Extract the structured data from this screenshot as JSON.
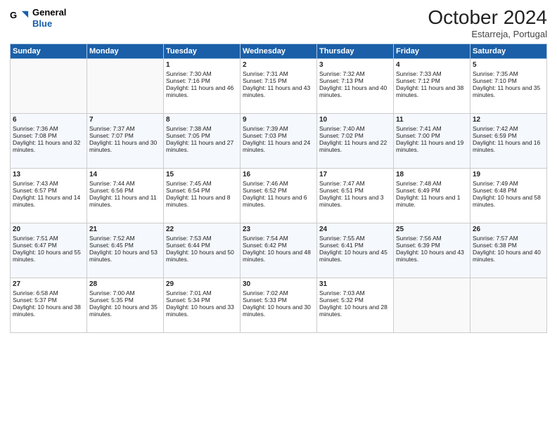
{
  "logo": {
    "line1": "General",
    "line2": "Blue"
  },
  "header": {
    "month_year": "October 2024",
    "location": "Estarreja, Portugal"
  },
  "days_of_week": [
    "Sunday",
    "Monday",
    "Tuesday",
    "Wednesday",
    "Thursday",
    "Friday",
    "Saturday"
  ],
  "weeks": [
    [
      {
        "day": "",
        "sunrise": "",
        "sunset": "",
        "daylight": ""
      },
      {
        "day": "",
        "sunrise": "",
        "sunset": "",
        "daylight": ""
      },
      {
        "day": "1",
        "sunrise": "Sunrise: 7:30 AM",
        "sunset": "Sunset: 7:16 PM",
        "daylight": "Daylight: 11 hours and 46 minutes."
      },
      {
        "day": "2",
        "sunrise": "Sunrise: 7:31 AM",
        "sunset": "Sunset: 7:15 PM",
        "daylight": "Daylight: 11 hours and 43 minutes."
      },
      {
        "day": "3",
        "sunrise": "Sunrise: 7:32 AM",
        "sunset": "Sunset: 7:13 PM",
        "daylight": "Daylight: 11 hours and 40 minutes."
      },
      {
        "day": "4",
        "sunrise": "Sunrise: 7:33 AM",
        "sunset": "Sunset: 7:12 PM",
        "daylight": "Daylight: 11 hours and 38 minutes."
      },
      {
        "day": "5",
        "sunrise": "Sunrise: 7:35 AM",
        "sunset": "Sunset: 7:10 PM",
        "daylight": "Daylight: 11 hours and 35 minutes."
      }
    ],
    [
      {
        "day": "6",
        "sunrise": "Sunrise: 7:36 AM",
        "sunset": "Sunset: 7:08 PM",
        "daylight": "Daylight: 11 hours and 32 minutes."
      },
      {
        "day": "7",
        "sunrise": "Sunrise: 7:37 AM",
        "sunset": "Sunset: 7:07 PM",
        "daylight": "Daylight: 11 hours and 30 minutes."
      },
      {
        "day": "8",
        "sunrise": "Sunrise: 7:38 AM",
        "sunset": "Sunset: 7:05 PM",
        "daylight": "Daylight: 11 hours and 27 minutes."
      },
      {
        "day": "9",
        "sunrise": "Sunrise: 7:39 AM",
        "sunset": "Sunset: 7:03 PM",
        "daylight": "Daylight: 11 hours and 24 minutes."
      },
      {
        "day": "10",
        "sunrise": "Sunrise: 7:40 AM",
        "sunset": "Sunset: 7:02 PM",
        "daylight": "Daylight: 11 hours and 22 minutes."
      },
      {
        "day": "11",
        "sunrise": "Sunrise: 7:41 AM",
        "sunset": "Sunset: 7:00 PM",
        "daylight": "Daylight: 11 hours and 19 minutes."
      },
      {
        "day": "12",
        "sunrise": "Sunrise: 7:42 AM",
        "sunset": "Sunset: 6:59 PM",
        "daylight": "Daylight: 11 hours and 16 minutes."
      }
    ],
    [
      {
        "day": "13",
        "sunrise": "Sunrise: 7:43 AM",
        "sunset": "Sunset: 6:57 PM",
        "daylight": "Daylight: 11 hours and 14 minutes."
      },
      {
        "day": "14",
        "sunrise": "Sunrise: 7:44 AM",
        "sunset": "Sunset: 6:56 PM",
        "daylight": "Daylight: 11 hours and 11 minutes."
      },
      {
        "day": "15",
        "sunrise": "Sunrise: 7:45 AM",
        "sunset": "Sunset: 6:54 PM",
        "daylight": "Daylight: 11 hours and 8 minutes."
      },
      {
        "day": "16",
        "sunrise": "Sunrise: 7:46 AM",
        "sunset": "Sunset: 6:52 PM",
        "daylight": "Daylight: 11 hours and 6 minutes."
      },
      {
        "day": "17",
        "sunrise": "Sunrise: 7:47 AM",
        "sunset": "Sunset: 6:51 PM",
        "daylight": "Daylight: 11 hours and 3 minutes."
      },
      {
        "day": "18",
        "sunrise": "Sunrise: 7:48 AM",
        "sunset": "Sunset: 6:49 PM",
        "daylight": "Daylight: 11 hours and 1 minute."
      },
      {
        "day": "19",
        "sunrise": "Sunrise: 7:49 AM",
        "sunset": "Sunset: 6:48 PM",
        "daylight": "Daylight: 10 hours and 58 minutes."
      }
    ],
    [
      {
        "day": "20",
        "sunrise": "Sunrise: 7:51 AM",
        "sunset": "Sunset: 6:47 PM",
        "daylight": "Daylight: 10 hours and 55 minutes."
      },
      {
        "day": "21",
        "sunrise": "Sunrise: 7:52 AM",
        "sunset": "Sunset: 6:45 PM",
        "daylight": "Daylight: 10 hours and 53 minutes."
      },
      {
        "day": "22",
        "sunrise": "Sunrise: 7:53 AM",
        "sunset": "Sunset: 6:44 PM",
        "daylight": "Daylight: 10 hours and 50 minutes."
      },
      {
        "day": "23",
        "sunrise": "Sunrise: 7:54 AM",
        "sunset": "Sunset: 6:42 PM",
        "daylight": "Daylight: 10 hours and 48 minutes."
      },
      {
        "day": "24",
        "sunrise": "Sunrise: 7:55 AM",
        "sunset": "Sunset: 6:41 PM",
        "daylight": "Daylight: 10 hours and 45 minutes."
      },
      {
        "day": "25",
        "sunrise": "Sunrise: 7:56 AM",
        "sunset": "Sunset: 6:39 PM",
        "daylight": "Daylight: 10 hours and 43 minutes."
      },
      {
        "day": "26",
        "sunrise": "Sunrise: 7:57 AM",
        "sunset": "Sunset: 6:38 PM",
        "daylight": "Daylight: 10 hours and 40 minutes."
      }
    ],
    [
      {
        "day": "27",
        "sunrise": "Sunrise: 6:58 AM",
        "sunset": "Sunset: 5:37 PM",
        "daylight": "Daylight: 10 hours and 38 minutes."
      },
      {
        "day": "28",
        "sunrise": "Sunrise: 7:00 AM",
        "sunset": "Sunset: 5:35 PM",
        "daylight": "Daylight: 10 hours and 35 minutes."
      },
      {
        "day": "29",
        "sunrise": "Sunrise: 7:01 AM",
        "sunset": "Sunset: 5:34 PM",
        "daylight": "Daylight: 10 hours and 33 minutes."
      },
      {
        "day": "30",
        "sunrise": "Sunrise: 7:02 AM",
        "sunset": "Sunset: 5:33 PM",
        "daylight": "Daylight: 10 hours and 30 minutes."
      },
      {
        "day": "31",
        "sunrise": "Sunrise: 7:03 AM",
        "sunset": "Sunset: 5:32 PM",
        "daylight": "Daylight: 10 hours and 28 minutes."
      },
      {
        "day": "",
        "sunrise": "",
        "sunset": "",
        "daylight": ""
      },
      {
        "day": "",
        "sunrise": "",
        "sunset": "",
        "daylight": ""
      }
    ]
  ]
}
